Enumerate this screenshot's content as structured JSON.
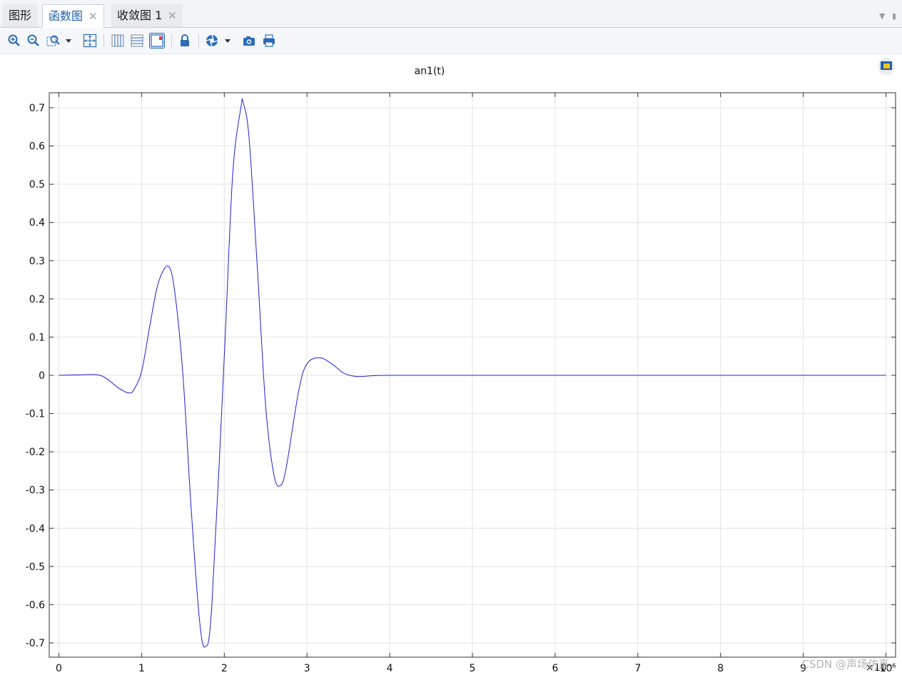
{
  "tabs": [
    {
      "label": "图形",
      "active": false,
      "closable": false
    },
    {
      "label": "函数图",
      "active": true,
      "closable": true
    },
    {
      "label": "收敛图 1",
      "active": false,
      "closable": true
    }
  ],
  "toolbar": {
    "icons": [
      "zoom-in-icon",
      "zoom-out-icon",
      "zoom-box-icon",
      "dropdown-arrow-icon",
      "zoom-extents-icon",
      "x-grid-icon",
      "y-grid-icon",
      "legend-icon",
      "lock-icon",
      "scene-light-icon",
      "dropdown-arrow-icon",
      "camera-icon",
      "print-icon"
    ]
  },
  "colors": {
    "series": "#1f1fd6",
    "accent": "#1f5fa6"
  },
  "watermark": "CSDN @声场仿真",
  "chart_data": {
    "type": "line",
    "title": "an1(t)",
    "xlabel": "",
    "ylabel": "",
    "x_multiplier_label": "×10⁻⁶",
    "xlim": [
      0,
      10
    ],
    "ylim": [
      -0.7,
      0.7
    ],
    "xticks": [
      "0",
      "1",
      "2",
      "3",
      "4",
      "5",
      "6",
      "7",
      "8",
      "9",
      "10"
    ],
    "yticks": [
      "0.7",
      "0.6",
      "0.5",
      "0.4",
      "0.3",
      "0.2",
      "0.1",
      "0",
      "-0.1",
      "-0.2",
      "-0.3",
      "-0.4",
      "-0.5",
      "-0.6",
      "-0.7"
    ],
    "grid": true,
    "series": [
      {
        "name": "",
        "x": [
          0,
          0.2,
          0.4,
          0.5,
          0.6,
          0.7,
          0.8,
          0.85,
          0.9,
          1.0,
          1.1,
          1.2,
          1.32,
          1.4,
          1.5,
          1.6,
          1.7,
          1.77,
          1.85,
          2.0,
          2.1,
          2.2,
          2.23,
          2.3,
          2.4,
          2.5,
          2.6,
          2.68,
          2.75,
          2.9,
          3.0,
          3.15,
          3.3,
          3.45,
          3.6,
          3.8,
          4.0,
          5.0,
          6.0,
          7.0,
          8.0,
          9.0,
          10.0
        ],
        "y": [
          0,
          0.001,
          0.002,
          0.0,
          -0.012,
          -0.03,
          -0.043,
          -0.046,
          -0.04,
          0.01,
          0.13,
          0.24,
          0.286,
          0.22,
          0.0,
          -0.35,
          -0.64,
          -0.71,
          -0.6,
          0.05,
          0.52,
          0.7,
          0.712,
          0.62,
          0.28,
          -0.08,
          -0.26,
          -0.288,
          -0.24,
          -0.04,
          0.03,
          0.046,
          0.03,
          0.005,
          -0.003,
          -0.001,
          0,
          0,
          0,
          0,
          0,
          0,
          0
        ]
      }
    ]
  }
}
